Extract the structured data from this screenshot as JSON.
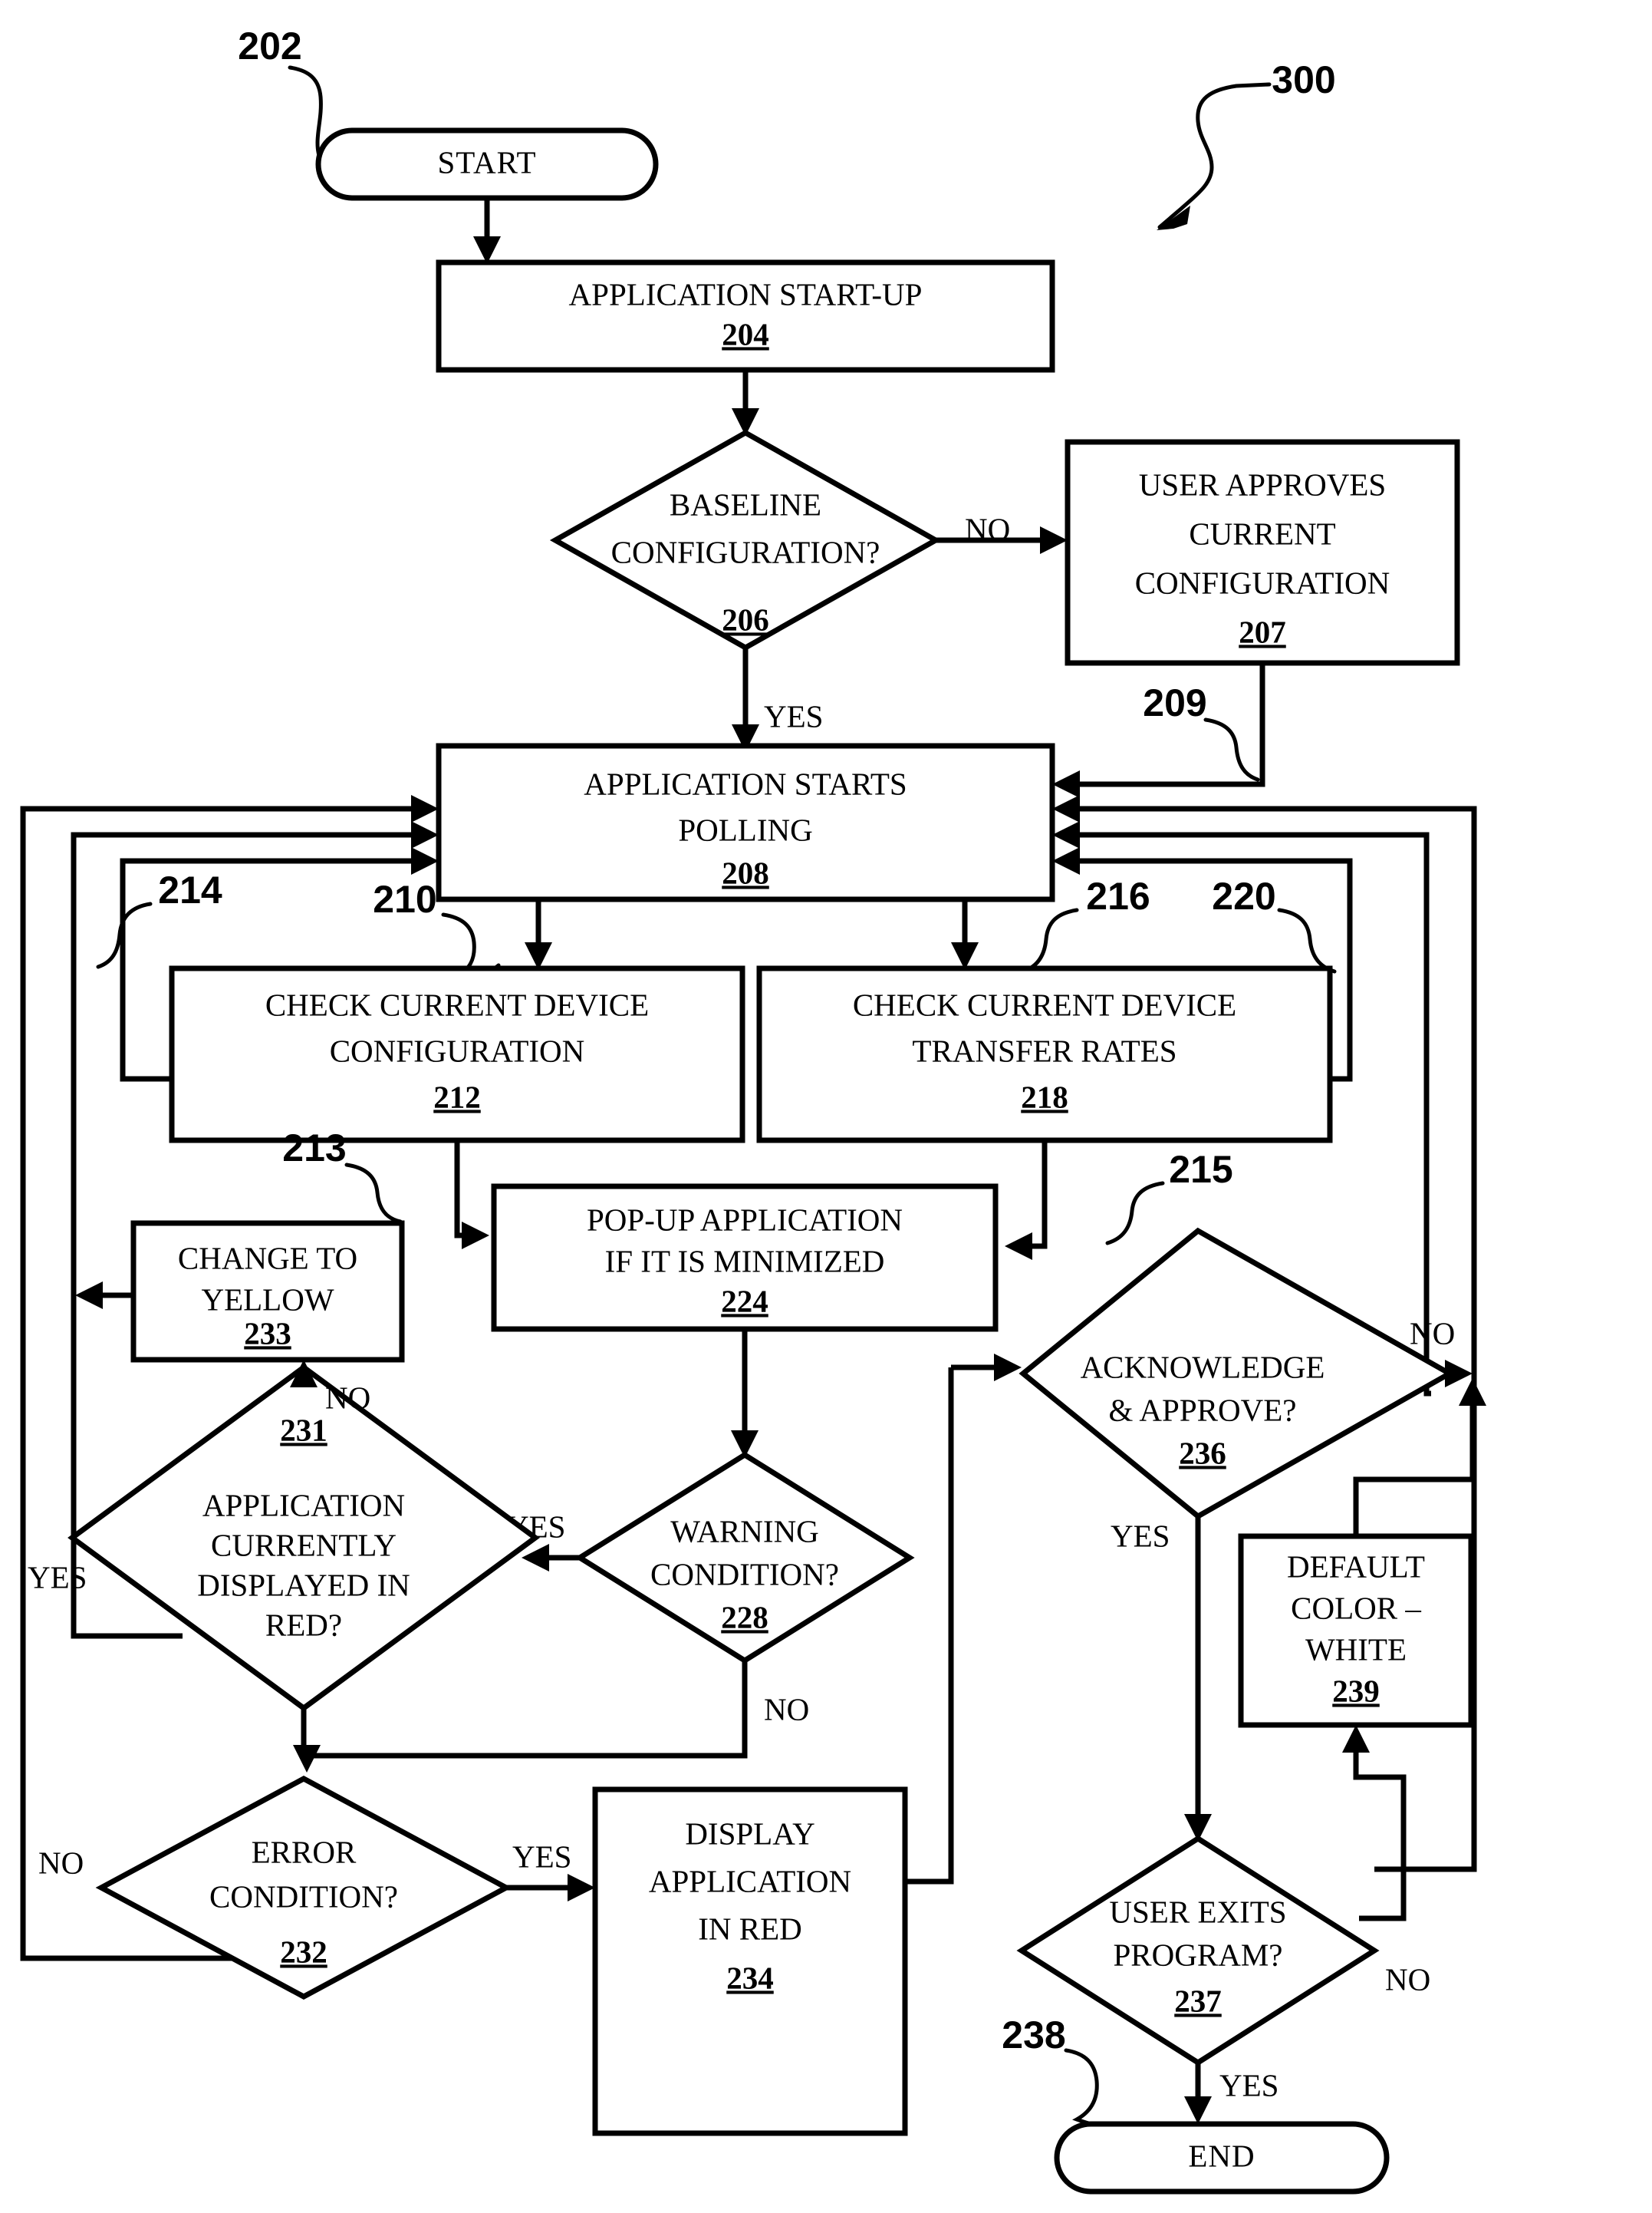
{
  "figure": {
    "label": "300",
    "start_ref": "202",
    "end_ref": "238"
  },
  "nodes": {
    "start": {
      "type": "terminator",
      "text": "START",
      "ref": ""
    },
    "startup": {
      "type": "process",
      "line1": "APPLICATION START-UP",
      "line2": "",
      "ref": "204"
    },
    "baseline": {
      "type": "decision",
      "line1": "BASELINE",
      "line2": "CONFIGURATION?",
      "ref": "206"
    },
    "approves": {
      "type": "process",
      "line1": "USER APPROVES",
      "line2": "CURRENT",
      "line3": "CONFIGURATION",
      "ref": "207"
    },
    "polling": {
      "type": "process",
      "line1": "APPLICATION STARTS",
      "line2": "POLLING",
      "ref": "208"
    },
    "checkcfg": {
      "type": "process",
      "line1": "CHECK CURRENT DEVICE",
      "line2": "CONFIGURATION",
      "ref": "212"
    },
    "checkrate": {
      "type": "process",
      "line1": "CHECK CURRENT DEVICE",
      "line2": "TRANSFER RATES",
      "ref": "218"
    },
    "popup": {
      "type": "process",
      "line1": "POP-UP APPLICATION",
      "line2": "IF IT IS MINIMIZED",
      "ref": "224"
    },
    "yellow": {
      "type": "process",
      "line1": "CHANGE TO",
      "line2": "YELLOW",
      "ref": "233"
    },
    "warning": {
      "type": "decision",
      "line1": "WARNING",
      "line2": "CONDITION?",
      "ref": "228"
    },
    "inred": {
      "type": "decision",
      "line1": "APPLICATION",
      "line2": "CURRENTLY",
      "line3": "DISPLAYED IN",
      "line4": "RED?",
      "ref": "231"
    },
    "error": {
      "type": "decision",
      "line1": "ERROR",
      "line2": "CONDITION?",
      "ref": "232"
    },
    "dispred": {
      "type": "process",
      "line1": "DISPLAY",
      "line2": "APPLICATION",
      "line3": "IN RED",
      "ref": "234"
    },
    "ack": {
      "type": "decision",
      "line1": "ACKNOWLEDGE",
      "line2": "& APPROVE?",
      "ref": "236"
    },
    "defaultcol": {
      "type": "process",
      "line1": "DEFAULT",
      "line2": "COLOR –",
      "line3": "WHITE",
      "ref": "239"
    },
    "exits": {
      "type": "decision",
      "line1": "USER EXITS",
      "line2": "PROGRAM?",
      "ref": "237"
    },
    "end": {
      "type": "terminator",
      "text": "END",
      "ref": ""
    }
  },
  "edge_labels": {
    "baseline_no": "NO",
    "baseline_yes": "YES",
    "warning_yes": "YES",
    "warning_no": "NO",
    "inred_no": "NO",
    "inred_yes": "YES",
    "error_no": "NO",
    "error_yes": "YES",
    "ack_no": "NO",
    "ack_yes": "YES",
    "exits_no": "NO",
    "exits_yes": "YES"
  },
  "leader_refs": {
    "l202": "202",
    "l300": "300",
    "l209": "209",
    "l214": "214",
    "l210": "210",
    "l216": "216",
    "l220": "220",
    "l213": "213",
    "l215": "215",
    "l238": "238"
  },
  "colors": {
    "ink": "#000000",
    "paper": "#ffffff"
  }
}
